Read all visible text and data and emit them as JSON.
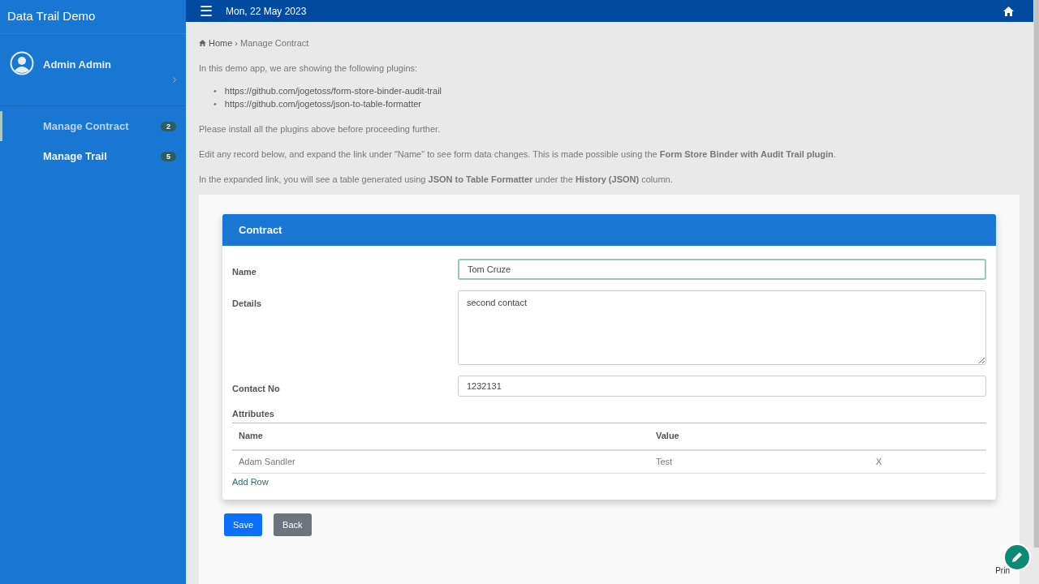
{
  "app": {
    "title": "Data Trail Demo"
  },
  "topbar": {
    "menu_icon": "☰",
    "date": "Mon, 22 May 2023"
  },
  "user": {
    "name": "Admin Admin"
  },
  "sidebar": {
    "items": [
      {
        "label": "Manage Contract",
        "badge": "2",
        "selected": true
      },
      {
        "label": "Manage Trail",
        "badge": "5",
        "selected": false
      }
    ]
  },
  "breadcrumb": [
    {
      "label": "Home"
    },
    {
      "label": "Manage Contract"
    }
  ],
  "breadcrumb_separator": "›",
  "bullet": "•",
  "intro": {
    "lead": "In this demo app, we are showing the following plugins:",
    "links": [
      "https://github.com/jogetoss/form-store-binder-audit-trail",
      "https://github.com/jogetoss/json-to-table-formatter"
    ],
    "paragraphs": [
      "Please install all the plugins above before proceeding further.",
      "Edit any record below, and expand the link under \"Name\" to see form data changes. This is made possible using the **Form Store Binder with Audit Trail plugin**.",
      "In the expanded link, you will see a table generated using **JSON to Table Formatter** under the **History (JSON)** column."
    ]
  },
  "form": {
    "title": "Contract",
    "fields": [
      {
        "label": "Name",
        "kind": "text",
        "value": "Tom Cruze",
        "focused": true
      },
      {
        "label": "Details",
        "kind": "textarea",
        "value": "second contact",
        "focused": false
      },
      {
        "label": "Contact No",
        "kind": "text",
        "value": "1232131",
        "focused": false
      }
    ],
    "attributes": {
      "label": "Attributes",
      "columns": [
        "Name",
        "Value"
      ],
      "rows": [
        {
          "name": "Adam Sandler",
          "value": "Test",
          "remove": "X"
        }
      ],
      "add_row": "Add Row"
    }
  },
  "buttons": [
    {
      "label": "Save",
      "kind": "primary"
    },
    {
      "label": "Back",
      "kind": "secondary"
    }
  ],
  "footer_text": "Prin"
}
